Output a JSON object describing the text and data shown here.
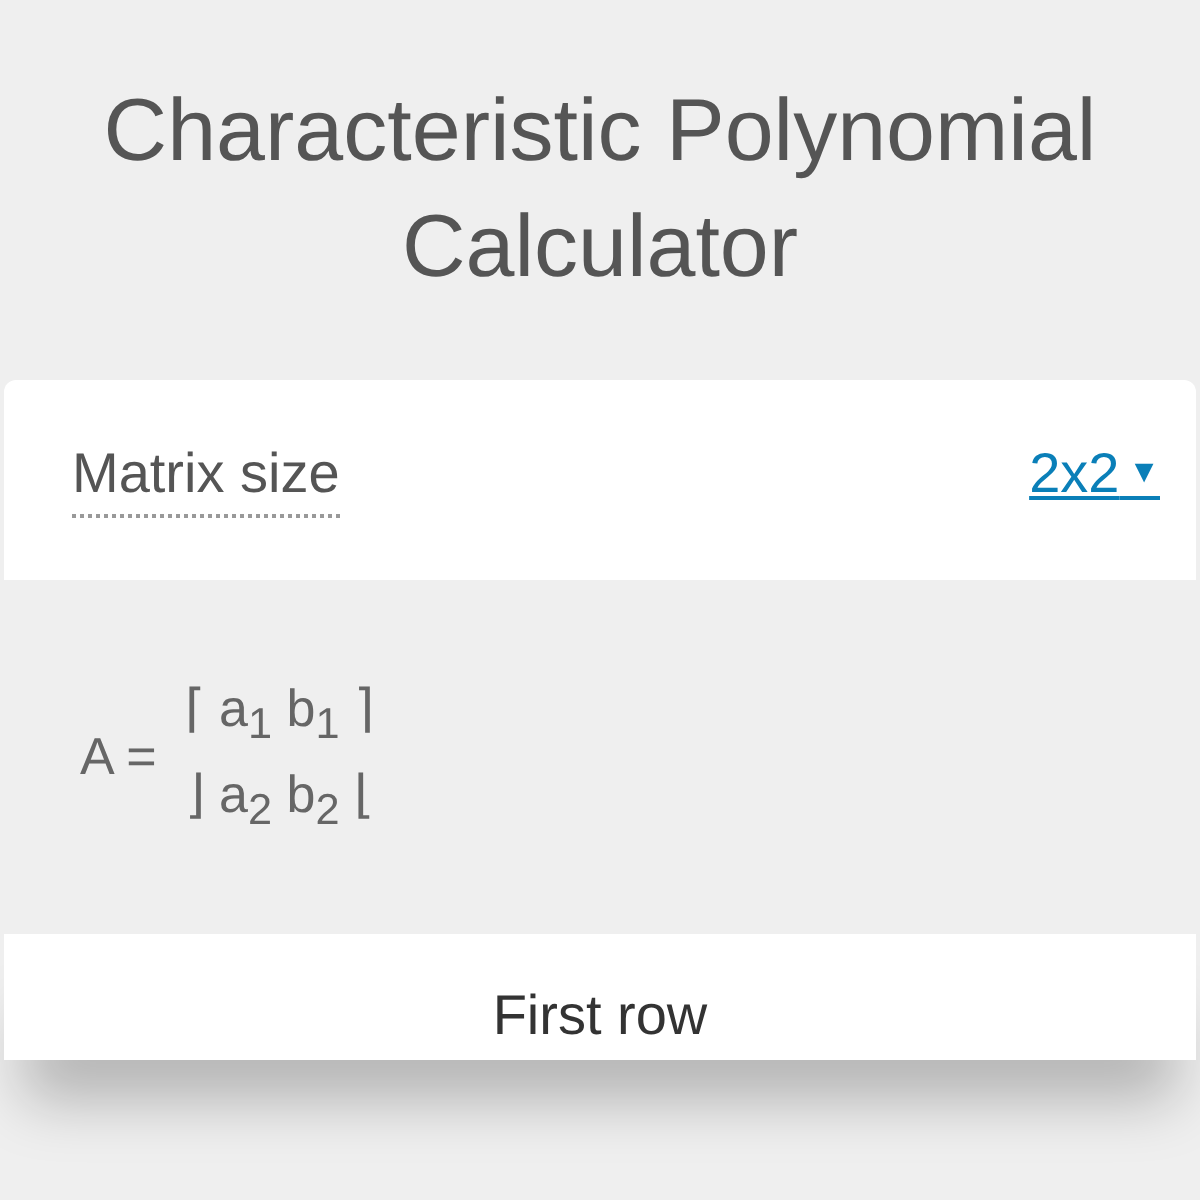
{
  "title": "Characteristic Polynomial Calculator",
  "matrix_size": {
    "label": "Matrix size",
    "value": "2x2",
    "arrow": "▼"
  },
  "matrix": {
    "label": "A =",
    "rows": [
      "⌈ a$_{1}$ b$_{1}$ ⌉",
      "⌋ a$_{2}$ b$_{2}$ ⌊"
    ]
  },
  "section": {
    "heading": "First row"
  }
}
